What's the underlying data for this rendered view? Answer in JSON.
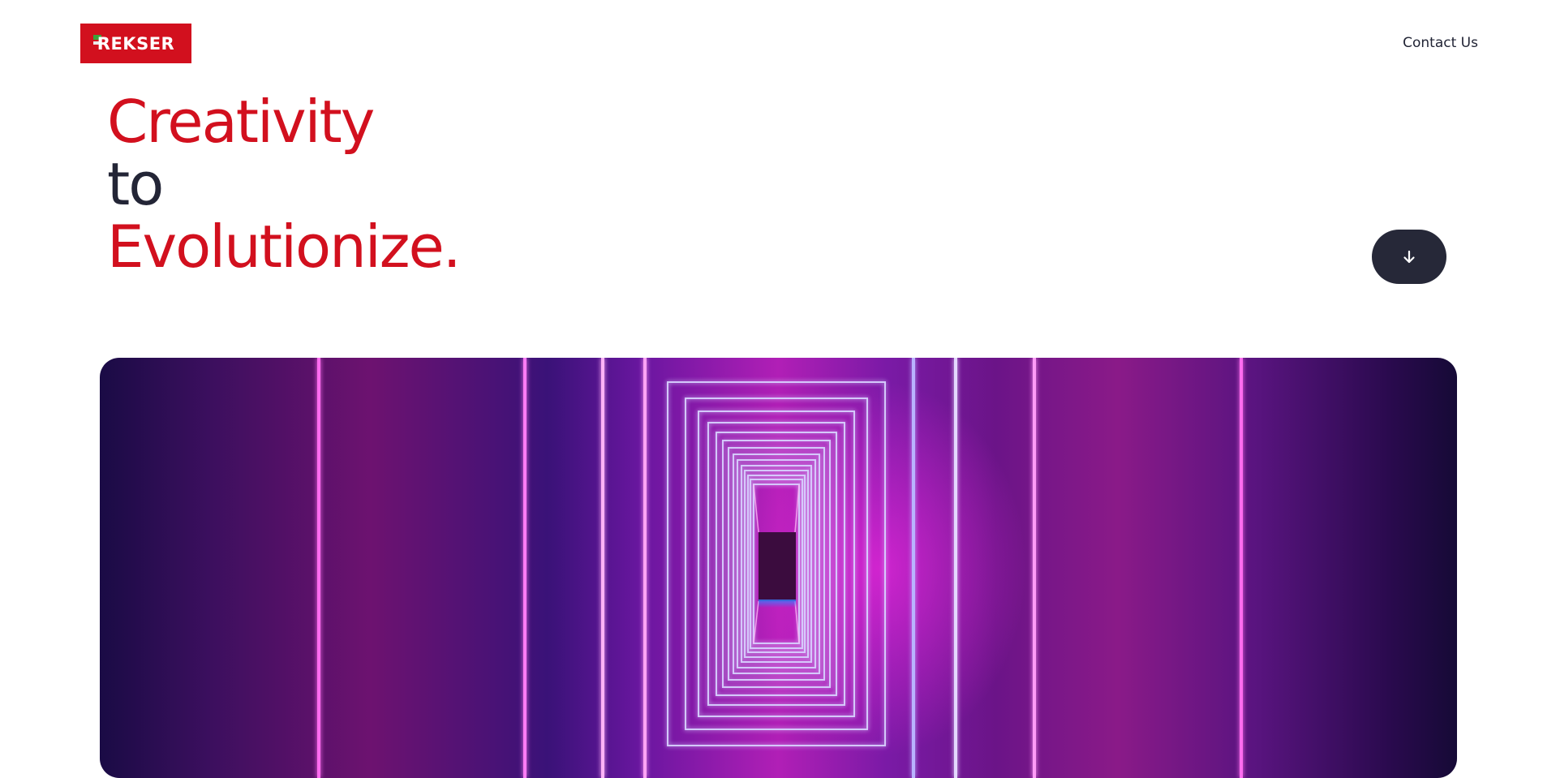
{
  "header": {
    "logo_text": "REKSER",
    "contact_label": "Contact Us"
  },
  "hero": {
    "headline_line1": "Creativity",
    "headline_line2": "to",
    "headline_line3": "Evolutionize.",
    "scroll_button_icon": "arrow-down-icon"
  },
  "colors": {
    "brand_red": "#d2101e",
    "dark": "#232536",
    "button_bg": "#262838",
    "white": "#ffffff"
  }
}
